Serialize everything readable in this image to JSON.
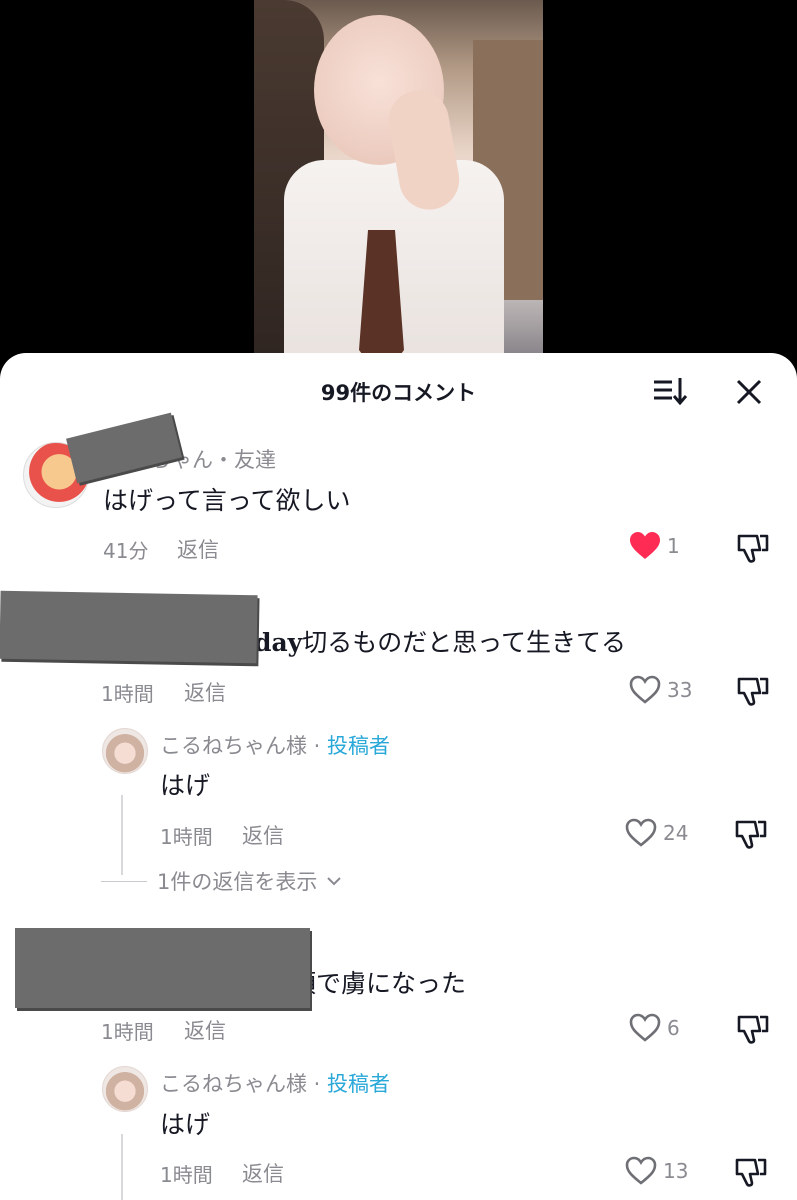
{
  "sheet": {
    "title": "99件のコメント"
  },
  "comments": [
    {
      "username": "ちゃん・友達",
      "text": "はげって言って欲しい",
      "time": "41分",
      "reply_label": "返信",
      "likes": "1",
      "liked": true
    },
    {
      "text_bold": "day",
      "text": "切るものだと思って生きてる",
      "time": "1時間",
      "reply_label": "返信",
      "likes": "33",
      "reply": {
        "username": "こるねちゃん様",
        "sep": " · ",
        "author_tag": "投稿者",
        "text": "はげ",
        "time": "1時間",
        "reply_label": "返信",
        "likes": "24"
      },
      "view_replies": "1件の返信を表示"
    },
    {
      "text": "頂で虜になった",
      "time": "1時間",
      "reply_label": "返信",
      "likes": "6",
      "reply": {
        "username": "こるねちゃん様",
        "sep": " · ",
        "author_tag": "投稿者",
        "text": "はげ",
        "time": "1時間",
        "reply_label": "返信",
        "likes": "13"
      }
    }
  ],
  "colors": {
    "liked_heart": "#fe2c55",
    "author_tag": "#2aa8d8",
    "text_primary": "#161823",
    "text_secondary": "#8a8b91"
  }
}
